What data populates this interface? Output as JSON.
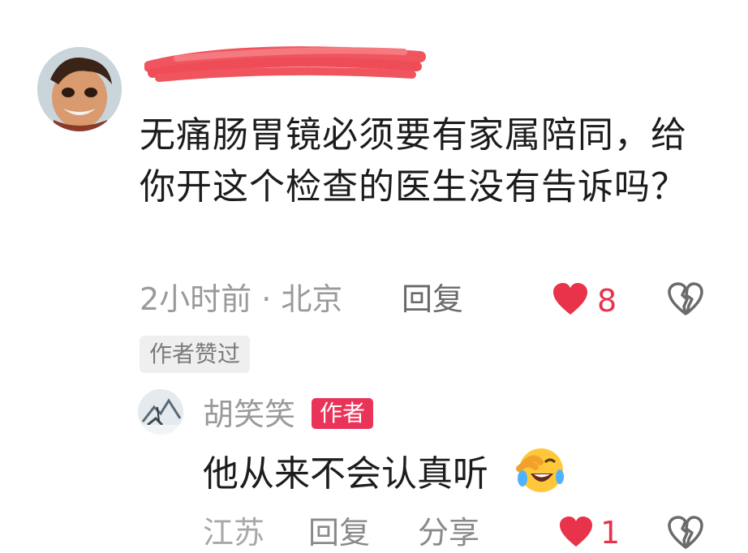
{
  "comment": {
    "text": "无痛肠胃镜必须要有家属陪同，给你开这个检查的医生没有告诉吗？",
    "meta": "2小时前 · 北京",
    "reply_label": "回复",
    "like_count": "8",
    "author_liked": "作者赞过"
  },
  "reply": {
    "username": "胡笑笑",
    "author_badge": "作者",
    "text": "他从来不会认真听",
    "meta_partial": "江苏",
    "reply_label": "回复",
    "share_label": "分享",
    "like_count": "1"
  },
  "colors": {
    "like_red": "#e8334a",
    "badge_pink": "#ea3358",
    "redaction": "#f0555e"
  }
}
